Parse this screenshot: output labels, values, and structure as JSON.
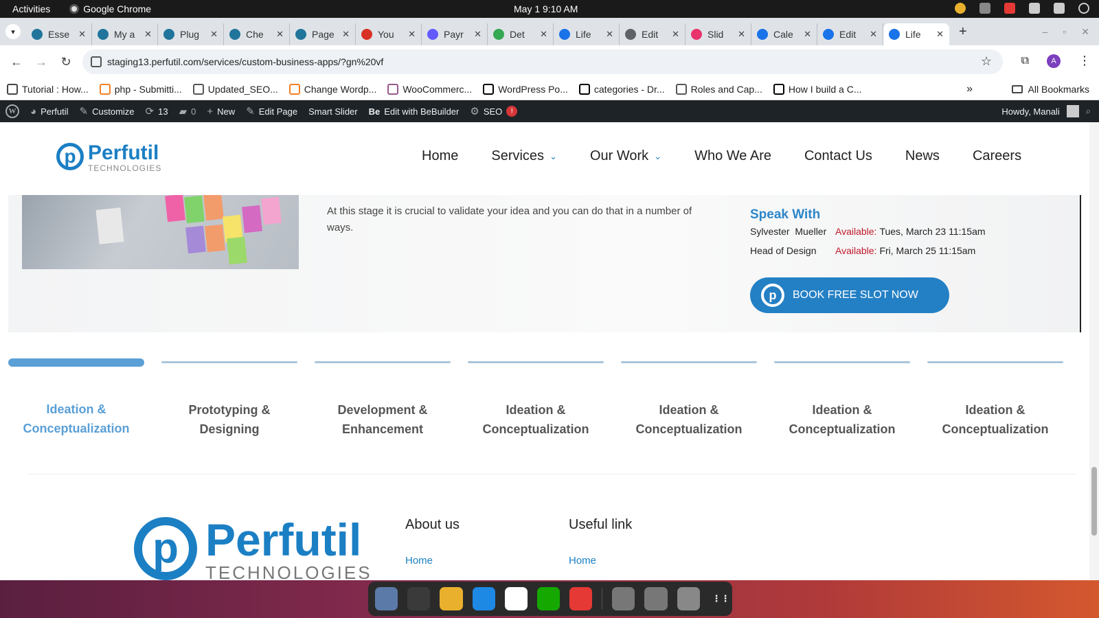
{
  "gnome": {
    "activities": "Activities",
    "app_name": "Google Chrome",
    "clock": "May 1  9:10 AM"
  },
  "tabs": [
    {
      "title": "Esse",
      "icon": "wordpress-icon",
      "color": "#21759b"
    },
    {
      "title": "My a",
      "icon": "wordpress-icon",
      "color": "#21759b"
    },
    {
      "title": "Plug",
      "icon": "wordpress-icon",
      "color": "#21759b"
    },
    {
      "title": "Che",
      "icon": "wordpress-icon",
      "color": "#21759b"
    },
    {
      "title": "Page",
      "icon": "wordpress-icon",
      "color": "#21759b"
    },
    {
      "title": "You",
      "icon": "gmail-icon",
      "color": "#d93025"
    },
    {
      "title": "Payr",
      "icon": "s-icon",
      "color": "#635bff"
    },
    {
      "title": "Det",
      "icon": "maps-icon",
      "color": "#34a853"
    },
    {
      "title": "Life",
      "icon": "be-icon",
      "color": "#1a73e8"
    },
    {
      "title": "Edit",
      "icon": "globe-icon",
      "color": "#5f6368"
    },
    {
      "title": "Slid",
      "icon": "slider-icon",
      "color": "#e8336d"
    },
    {
      "title": "Cale",
      "icon": "calendar-icon",
      "color": "#1a73e8"
    },
    {
      "title": "Edit",
      "icon": "n-icon",
      "color": "#1a73e8"
    },
    {
      "title": "Life",
      "icon": "be-icon",
      "color": "#1a73e8",
      "active": true
    }
  ],
  "address": {
    "url": "staging13.perfutil.com/services/custom-business-apps/?gn%20vf"
  },
  "bookmarks": [
    {
      "label": "Tutorial : How...",
      "icon": "tutorial-icon",
      "color": "#444"
    },
    {
      "label": "php - Submitti...",
      "icon": "stackoverflow-icon",
      "color": "#f48024"
    },
    {
      "label": "Updated_SEO...",
      "icon": "globe-icon",
      "color": "#555"
    },
    {
      "label": "Change Wordp...",
      "icon": "stackoverflow-icon",
      "color": "#f48024"
    },
    {
      "label": "WooCommerc...",
      "icon": "woocommerce-icon",
      "color": "#96588a"
    },
    {
      "label": "WordPress Po...",
      "icon": "medium-icon",
      "color": "#000"
    },
    {
      "label": "categories - Dr...",
      "icon": "wikipedia-icon",
      "color": "#000"
    },
    {
      "label": "Roles and Cap...",
      "icon": "wordpress-icon",
      "color": "#555"
    },
    {
      "label": "How I build a C...",
      "icon": "video-icon",
      "color": "#000"
    }
  ],
  "bookmarks_all": "All Bookmarks",
  "wpbar": {
    "site": "Perfutil",
    "customize": "Customize",
    "updates": "13",
    "comments": "0",
    "new": "New",
    "edit_page": "Edit Page",
    "smart_slider": "Smart Slider",
    "bebuilder": "Edit with BeBuilder",
    "seo": "SEO",
    "seo_badge": "!",
    "howdy": "Howdy, Manali"
  },
  "site": {
    "logo_name": "Perfutil",
    "logo_sub": "TECHNOLOGIES",
    "nav": [
      {
        "label": "Home",
        "dropdown": false
      },
      {
        "label": "Services",
        "dropdown": true
      },
      {
        "label": "Our Work",
        "dropdown": true
      },
      {
        "label": "Who We Are",
        "dropdown": false
      },
      {
        "label": "Contact Us",
        "dropdown": false
      },
      {
        "label": "News",
        "dropdown": false
      },
      {
        "label": "Careers",
        "dropdown": false
      }
    ]
  },
  "hero": {
    "text": "At this stage it is crucial to validate your idea and you can do that in a number of ways.",
    "speak_title": "Speak With",
    "slots": [
      {
        "who": "Sylvester  Mueller",
        "available_label": "Available:",
        "time": "Tues, March 23 11:15am"
      },
      {
        "who": "Head of Design",
        "available_label": "Available:",
        "time": "Fri, March 25 11:15am"
      }
    ],
    "book_button": "BOOK FREE SLOT NOW"
  },
  "steps": [
    {
      "line1": "Ideation &",
      "line2": "Conceptualization",
      "active": true
    },
    {
      "line1": "Prototyping &",
      "line2": "Designing",
      "active": false
    },
    {
      "line1": "Development &",
      "line2": "Enhancement",
      "active": false
    },
    {
      "line1": "Ideation &",
      "line2": "Conceptualization",
      "active": false
    },
    {
      "line1": "Ideation &",
      "line2": "Conceptualization",
      "active": false
    },
    {
      "line1": "Ideation &",
      "line2": "Conceptualization",
      "active": false
    },
    {
      "line1": "Ideation &",
      "line2": "Conceptualization",
      "active": false
    }
  ],
  "footer": {
    "logo_name": "Perfutil",
    "logo_sub": "TECHNOLOGIES",
    "col1_title": "About us",
    "col1_link": "Home",
    "col2_title": "Useful link",
    "col2_link": "Home"
  },
  "colors": {
    "brand_blue": "#1b7fc4",
    "accent_light": "#5a9fd6",
    "available_red": "#c0182a",
    "wp_bar": "#1d2327"
  },
  "dock": [
    {
      "icon": "files-icon",
      "color": "#5b7aa8"
    },
    {
      "icon": "terminal-icon",
      "color": "#3a3a3a"
    },
    {
      "icon": "chrome-icon",
      "color": "#e9b02e"
    },
    {
      "icon": "vscode-icon",
      "color": "#1e88e5"
    },
    {
      "icon": "slack-icon",
      "color": "#ffffff"
    },
    {
      "icon": "upwork-icon",
      "color": "#14a800"
    },
    {
      "icon": "anydesk-icon",
      "color": "#e53935"
    },
    {
      "icon": "disk-icon",
      "color": "#777"
    },
    {
      "icon": "disk-icon",
      "color": "#777"
    },
    {
      "icon": "trash-icon",
      "color": "#888"
    },
    {
      "icon": "apps-grid-icon",
      "color": "#2a2a2a"
    }
  ]
}
